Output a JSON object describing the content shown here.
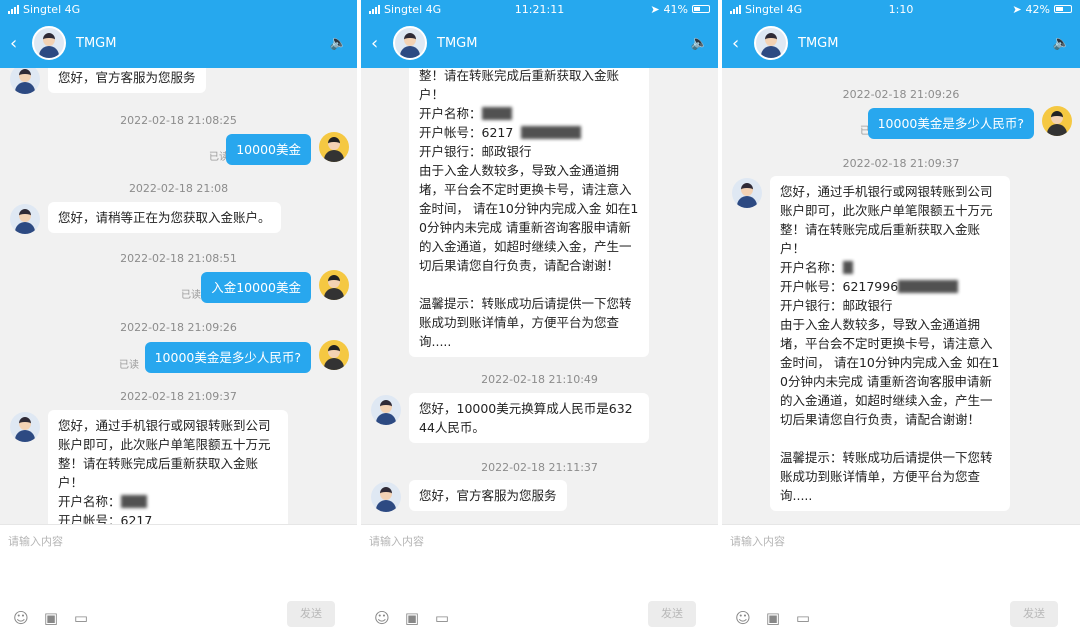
{
  "panels": [
    {
      "status": {
        "carrier": "Singtel 4G",
        "time": "",
        "battery": ""
      },
      "chat_title": "TMGM",
      "input_placeholder": "请输入内容",
      "send_label": "发送",
      "messages": [
        {
          "text": "您好，官方客服为您服务"
        },
        {
          "ts": "2022-02-18 21:08:25"
        },
        {
          "text": "10000美金",
          "read": "已读"
        },
        {
          "ts": "2022-02-18 21:08"
        },
        {
          "text": "您好，请稍等正在为您获取入金账户。"
        },
        {
          "ts": "2022-02-18 21:08:51"
        },
        {
          "text": "入金10000美金",
          "read": "已读"
        },
        {
          "ts": "2022-02-18 21:09:26"
        },
        {
          "text": "10000美金是多少人民币?",
          "read": "已读"
        },
        {
          "ts": "2022-02-18 21:09:37"
        },
        {
          "text": "您好，通过手机银行或网银转账到公司账户即可，此次账户单笔限额五十万元整！请在转账完成后重新获取入金账户！",
          "acct_name": "开户名称：",
          "acct_no": "开户帐号：6217"
        }
      ]
    },
    {
      "status": {
        "carrier": "Singtel 4G",
        "time": "11:21:11",
        "battery": "41%"
      },
      "chat_title": "TMGM",
      "input_placeholder": "请输入内容",
      "send_label": "发送",
      "messages": [
        {
          "l1": "整！请在转账完成后重新获取入金账户！",
          "acct_name": "开户名称：",
          "acct_no": "开户帐号：6217",
          "bank": "开户银行：邮政银行",
          "body": "由于入金人数较多，导致入金通道拥堵，平台会不定时更换卡号，请注意入金时间， 请在10分钟内完成入金 如在10分钟内未完成 请重新咨询客服申请新的入金通道，如超时继续入金，产生一切后果请您自行负责，请配合谢谢！",
          "tip": "温馨提示：转账成功后请提供一下您转账成功到账详情单，方便平台为您查询....."
        },
        {
          "ts": "2022-02-18 21:10:49"
        },
        {
          "text": "您好，10000美元换算成人民币是63244人民币。"
        },
        {
          "ts": "2022-02-18 21:11:37"
        },
        {
          "text": "您好，官方客服为您服务"
        }
      ]
    },
    {
      "status": {
        "carrier": "Singtel 4G",
        "time": "1:10",
        "battery": "42%"
      },
      "chat_title": "TMGM",
      "input_placeholder": "请输入内容",
      "send_label": "发送",
      "messages": [
        {
          "ts": "2022-02-18 21:09:26"
        },
        {
          "text": "10000美金是多少人民币?",
          "read": "已读"
        },
        {
          "ts": "2022-02-18 21:09:37"
        },
        {
          "text": "您好，通过手机银行或网银转账到公司账户即可，此次账户单笔限额五十万元整！请在转账完成后重新获取入金账户！",
          "acct_name": "开户名称：",
          "acct_no": "开户帐号：6217996",
          "bank": "开户银行：邮政银行",
          "body": "由于入金人数较多，导致入金通道拥堵，平台会不定时更换卡号，请注意入金时间， 请在10分钟内完成入金 如在10分钟内未完成 请重新咨询客服申请新的入金通道，如超时继续入金，产生一切后果请您自行负责，请配合谢谢！",
          "tip": "温馨提示：转账成功后请提供一下您转账成功到账详情单，方便平台为您查询....."
        }
      ]
    }
  ]
}
